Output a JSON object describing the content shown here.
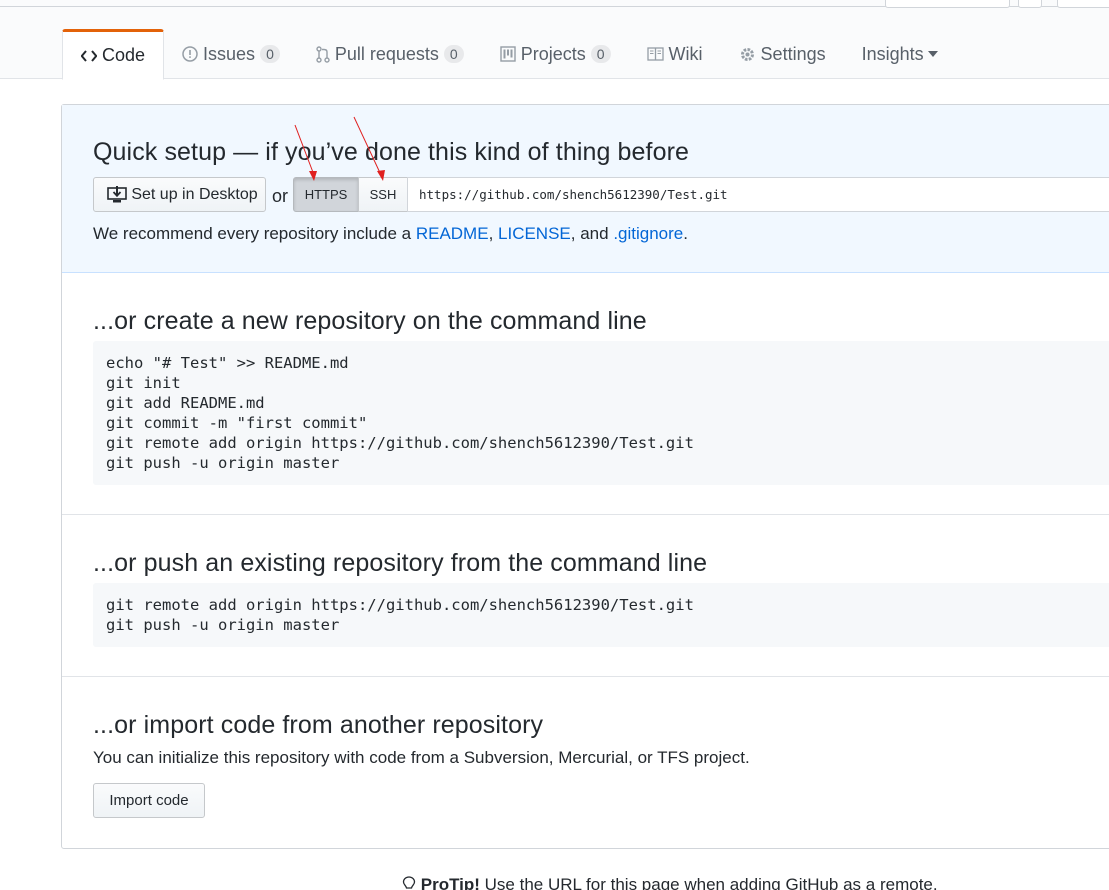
{
  "tabs": [
    {
      "label": "Code",
      "icon": "code-icon",
      "selected": true
    },
    {
      "label": "Issues",
      "icon": "issue-icon",
      "count": "0"
    },
    {
      "label": "Pull requests",
      "icon": "pull-request-icon",
      "count": "0"
    },
    {
      "label": "Projects",
      "icon": "project-icon",
      "count": "0"
    },
    {
      "label": "Wiki",
      "icon": "book-icon"
    },
    {
      "label": "Settings",
      "icon": "gear-icon"
    },
    {
      "label": "Insights",
      "icon": "caret-down-icon"
    }
  ],
  "quick_setup": {
    "title": "Quick setup — if you’ve done this kind of thing before",
    "desktop_button": "Set up in Desktop",
    "or": "or",
    "https_label": "HTTPS",
    "ssh_label": "SSH",
    "clone_url": "https://github.com/shench5612390/Test.git",
    "recommend": {
      "prefix": "We recommend every repository include a ",
      "readme": "README",
      "comma1": ", ",
      "license": "LICENSE",
      "and": ", and ",
      "gitignore": ".gitignore",
      "end": "."
    }
  },
  "create_section": {
    "title": "...or create a new repository on the command line",
    "code": "echo \"# Test\" >> README.md\ngit init\ngit add README.md\ngit commit -m \"first commit\"\ngit remote add origin https://github.com/shench5612390/Test.git\ngit push -u origin master"
  },
  "push_section": {
    "title": "...or push an existing repository from the command line",
    "code": "git remote add origin https://github.com/shench5612390/Test.git\ngit push -u origin master"
  },
  "import_section": {
    "title": "...or import code from another repository",
    "description": "You can initialize this repository with code from a Subversion, Mercurial, or TFS project.",
    "button": "Import code"
  },
  "protip": {
    "label": "ProTip!",
    "text": " Use the URL for this page when adding GitHub as a remote."
  },
  "colors": {
    "tab_accent": "#e36209",
    "link": "#0366d6",
    "quick_bg": "#f1f8ff",
    "annotation_arrow": "#e02020"
  }
}
